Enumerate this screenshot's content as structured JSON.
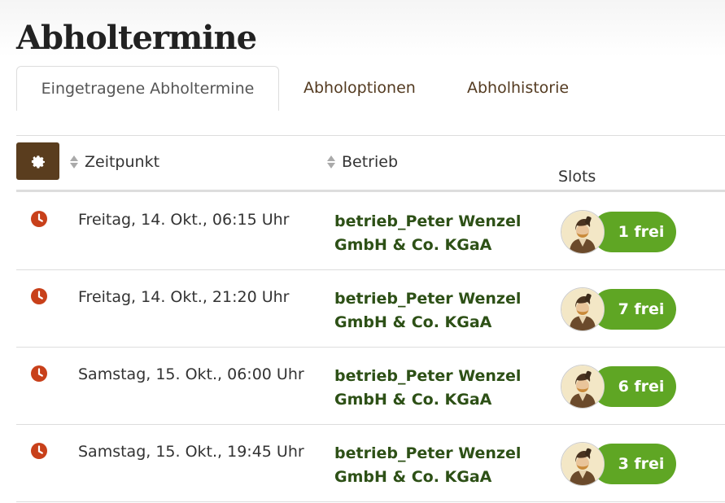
{
  "page": {
    "title": "Abholtermine"
  },
  "tabs": [
    {
      "label": "Eingetragene Abholtermine",
      "active": true
    },
    {
      "label": "Abholoptionen",
      "active": false
    },
    {
      "label": "Abholhistorie",
      "active": false
    }
  ],
  "table": {
    "settings_icon": "gear-icon",
    "headers": {
      "time": "Zeitpunkt",
      "company": "Betrieb",
      "slots": "Slots"
    },
    "rows": [
      {
        "time": "Freitag, 14. Okt., 06:15 Uhr",
        "company_line1": "betrieb_Peter Wenzel",
        "company_line2": "GmbH & Co. KGaA",
        "slots": "1 frei"
      },
      {
        "time": "Freitag, 14. Okt., 21:20 Uhr",
        "company_line1": "betrieb_Peter Wenzel",
        "company_line2": "GmbH & Co. KGaA",
        "slots": "7 frei"
      },
      {
        "time": "Samstag, 15. Okt., 06:00 Uhr",
        "company_line1": "betrieb_Peter Wenzel",
        "company_line2": "GmbH & Co. KGaA",
        "slots": "6 frei"
      },
      {
        "time": "Samstag, 15. Okt., 19:45 Uhr",
        "company_line1": "betrieb_Peter Wenzel",
        "company_line2": "GmbH & Co. KGaA",
        "slots": "3 frei"
      }
    ]
  },
  "colors": {
    "accent_brown": "#5a3d1e",
    "clock_red": "#c8401a",
    "company_green": "#2d5016",
    "slot_green": "#5fa624"
  }
}
